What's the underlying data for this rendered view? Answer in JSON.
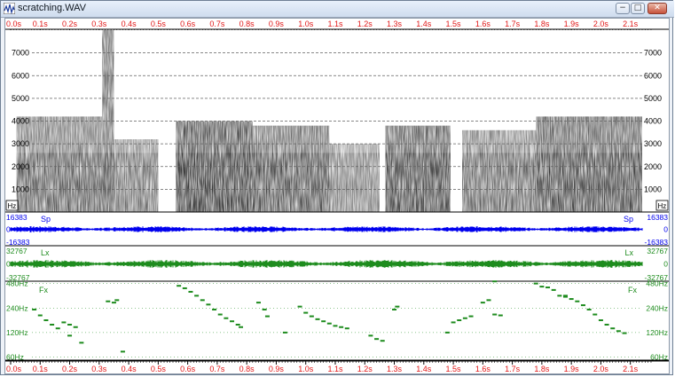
{
  "window": {
    "title": "scratching.WAV",
    "controls": {
      "minimize": "−",
      "maximize": "□",
      "close": "✕"
    },
    "icon": "waveform-app-icon"
  },
  "colors": {
    "time_axis": "#e01818",
    "speech_wave": "#0000ee",
    "larynx_wave": "#1e8c1e",
    "fx_track": "#1e8c1e",
    "grid": "#606060"
  },
  "time_axis": {
    "labels": [
      "0.0s",
      "0.1s",
      "0.2s",
      "0.3s",
      "0.4s",
      "0.5s",
      "0.6s",
      "0.7s",
      "0.8s",
      "0.9s",
      "1.0s",
      "1.1s",
      "1.2s",
      "1.3s",
      "1.4s",
      "1.5s",
      "1.6s",
      "1.7s",
      "1.8s",
      "1.9s",
      "2.0s",
      "2.1s"
    ],
    "values": [
      0.0,
      0.1,
      0.2,
      0.3,
      0.4,
      0.5,
      0.6,
      0.7,
      0.8,
      0.9,
      1.0,
      1.1,
      1.2,
      1.3,
      1.4,
      1.5,
      1.6,
      1.7,
      1.8,
      1.9,
      2.0,
      2.1
    ],
    "range": [
      0.0,
      2.14
    ]
  },
  "spectrogram": {
    "unit": "Hz",
    "labels": [
      "7000",
      "6000",
      "5000",
      "4000",
      "3000",
      "2000",
      "1000"
    ],
    "values": [
      7000,
      6000,
      5000,
      4000,
      3000,
      2000,
      1000
    ],
    "range": [
      0,
      8000
    ],
    "segments": [
      {
        "t": [
          0.02,
          0.31
        ],
        "f": [
          0,
          4200
        ],
        "level": 0.55
      },
      {
        "t": [
          0.31,
          0.35
        ],
        "f": [
          0,
          8000
        ],
        "level": 0.6
      },
      {
        "t": [
          0.35,
          0.5
        ],
        "f": [
          0,
          3200
        ],
        "level": 0.45
      },
      {
        "t": [
          0.56,
          0.82
        ],
        "f": [
          0,
          4000
        ],
        "level": 0.7
      },
      {
        "t": [
          0.82,
          1.08
        ],
        "f": [
          0,
          3800
        ],
        "level": 0.6
      },
      {
        "t": [
          1.08,
          1.25
        ],
        "f": [
          0,
          3000
        ],
        "level": 0.4
      },
      {
        "t": [
          1.27,
          1.49
        ],
        "f": [
          0,
          3800
        ],
        "level": 0.65
      },
      {
        "t": [
          1.53,
          1.78
        ],
        "f": [
          0,
          3600
        ],
        "level": 0.5
      },
      {
        "t": [
          1.78,
          2.14
        ],
        "f": [
          0,
          4200
        ],
        "level": 0.65
      }
    ]
  },
  "speech_track": {
    "label": "Sp",
    "max_label": "16383",
    "zero_label": "0",
    "min_label": "-16383"
  },
  "larynx_track": {
    "label": "Lx",
    "max_label": "32767",
    "zero_label": "0",
    "min_label": "-32767"
  },
  "fx_track": {
    "label": "Fx",
    "labels": [
      "480Hz",
      "240Hz",
      "120Hz",
      "60Hz"
    ],
    "values": [
      480,
      240,
      120,
      60
    ],
    "range": [
      55,
      500
    ],
    "scale": "log",
    "points": [
      [
        0.08,
        230
      ],
      [
        0.1,
        195
      ],
      [
        0.12,
        170
      ],
      [
        0.14,
        150
      ],
      [
        0.16,
        135
      ],
      [
        0.18,
        160
      ],
      [
        0.2,
        150
      ],
      [
        0.22,
        140
      ],
      [
        0.24,
        90
      ],
      [
        0.2,
        110
      ],
      [
        0.33,
        290
      ],
      [
        0.35,
        280
      ],
      [
        0.36,
        300
      ],
      [
        0.38,
        70
      ],
      [
        0.57,
        450
      ],
      [
        0.59,
        420
      ],
      [
        0.61,
        380
      ],
      [
        0.63,
        340
      ],
      [
        0.65,
        300
      ],
      [
        0.67,
        265
      ],
      [
        0.69,
        230
      ],
      [
        0.71,
        200
      ],
      [
        0.73,
        180
      ],
      [
        0.75,
        165
      ],
      [
        0.77,
        150
      ],
      [
        0.78,
        140
      ],
      [
        0.84,
        280
      ],
      [
        0.86,
        230
      ],
      [
        0.87,
        190
      ],
      [
        0.93,
        120
      ],
      [
        0.98,
        250
      ],
      [
        1.0,
        210
      ],
      [
        1.02,
        190
      ],
      [
        1.04,
        175
      ],
      [
        1.06,
        165
      ],
      [
        1.08,
        155
      ],
      [
        1.1,
        145
      ],
      [
        1.12,
        140
      ],
      [
        1.14,
        135
      ],
      [
        1.22,
        110
      ],
      [
        1.24,
        100
      ],
      [
        1.26,
        95
      ],
      [
        1.3,
        230
      ],
      [
        1.31,
        250
      ],
      [
        1.48,
        120
      ],
      [
        1.5,
        160
      ],
      [
        1.52,
        170
      ],
      [
        1.54,
        180
      ],
      [
        1.56,
        190
      ],
      [
        1.6,
        280
      ],
      [
        1.62,
        300
      ],
      [
        1.64,
        200
      ],
      [
        1.66,
        195
      ],
      [
        1.64,
        510
      ],
      [
        1.78,
        480
      ],
      [
        1.8,
        440
      ],
      [
        1.82,
        430
      ],
      [
        1.84,
        400
      ],
      [
        1.86,
        340
      ],
      [
        1.88,
        330
      ],
      [
        1.9,
        310
      ],
      [
        1.92,
        290
      ],
      [
        1.94,
        260
      ],
      [
        1.96,
        230
      ],
      [
        1.98,
        200
      ],
      [
        2.0,
        170
      ],
      [
        2.02,
        150
      ],
      [
        2.04,
        135
      ],
      [
        2.06,
        125
      ],
      [
        2.08,
        118
      ],
      [
        1.88,
        340
      ]
    ]
  }
}
